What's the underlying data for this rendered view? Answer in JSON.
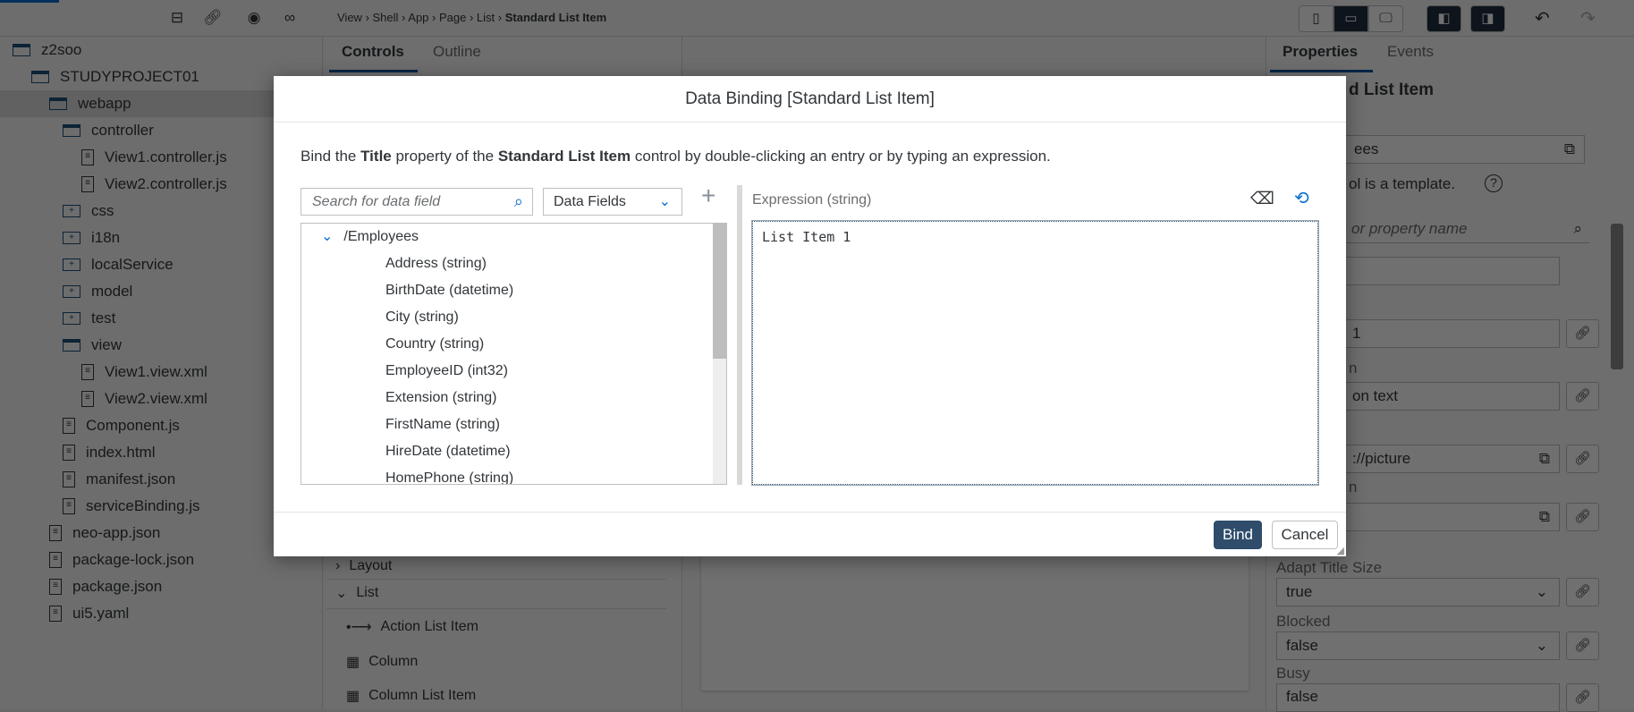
{
  "toolbar": {
    "breadcrumb": [
      "View",
      "Shell",
      "App",
      "Page",
      "List"
    ],
    "breadcrumb_current": "Standard List Item",
    "left_icons": [
      "collapse-all-icon",
      "link-icon",
      "eye-icon",
      "binoculars-icon"
    ]
  },
  "tree": [
    {
      "label": "z2soo",
      "type": "folder-open",
      "level": 0
    },
    {
      "label": "STUDYPROJECT01",
      "type": "folder-open",
      "level": 1
    },
    {
      "label": "webapp",
      "type": "folder-open",
      "level": 2,
      "selected": true
    },
    {
      "label": "controller",
      "type": "folder-open",
      "level": 3
    },
    {
      "label": "View1.controller.js",
      "type": "file",
      "level": 4
    },
    {
      "label": "View2.controller.js",
      "type": "file",
      "level": 4
    },
    {
      "label": "css",
      "type": "folder-closed",
      "level": 3
    },
    {
      "label": "i18n",
      "type": "folder-closed",
      "level": 3
    },
    {
      "label": "localService",
      "type": "folder-closed",
      "level": 3
    },
    {
      "label": "model",
      "type": "folder-closed",
      "level": 3
    },
    {
      "label": "test",
      "type": "folder-closed",
      "level": 3
    },
    {
      "label": "view",
      "type": "folder-open",
      "level": 3
    },
    {
      "label": "View1.view.xml",
      "type": "file",
      "level": 4
    },
    {
      "label": "View2.view.xml",
      "type": "file",
      "level": 4
    },
    {
      "label": "Component.js",
      "type": "file",
      "level": 3
    },
    {
      "label": "index.html",
      "type": "file",
      "level": 3
    },
    {
      "label": "manifest.json",
      "type": "file",
      "level": 3
    },
    {
      "label": "serviceBinding.js",
      "type": "file",
      "level": 3
    },
    {
      "label": "neo-app.json",
      "type": "file",
      "level": 2
    },
    {
      "label": "package-lock.json",
      "type": "file",
      "level": 2
    },
    {
      "label": "package.json",
      "type": "file",
      "level": 2
    },
    {
      "label": "ui5.yaml",
      "type": "file",
      "level": 2
    }
  ],
  "controls": {
    "tabs": [
      "Controls",
      "Outline"
    ],
    "active_tab": "Controls",
    "groups": [
      {
        "label": "Layout",
        "expanded": false
      },
      {
        "label": "List",
        "expanded": true
      }
    ],
    "items": [
      "Action List Item",
      "Column",
      "Column List Item"
    ]
  },
  "properties": {
    "tabs": [
      "Properties",
      "Events"
    ],
    "active_tab": "Properties",
    "title": "d List Item",
    "items_value": "ees",
    "template_note": "ol is a template.",
    "search_placeholder": "or property name",
    "title_value": "1",
    "label2": "n",
    "desc_value": "on text",
    "icon_value": "://picture",
    "label4": "n",
    "adapt_label": "Adapt Title Size",
    "adapt_value": "true",
    "blocked_label": "Blocked",
    "blocked_value": "false",
    "busy_label": "Busy",
    "busy_value": "false"
  },
  "dialog": {
    "title": "Data Binding [Standard List Item]",
    "desc_pre": "Bind the ",
    "desc_prop": "Title",
    "desc_mid": " property of the ",
    "desc_ctrl": "Standard List Item",
    "desc_post": " control by double-clicking an entry or by typing an expression.",
    "search_placeholder": "Search for data field",
    "filter_value": "Data Fields",
    "root": "/Employees",
    "fields": [
      "Address (string)",
      "BirthDate (datetime)",
      "City (string)",
      "Country (string)",
      "EmployeeID (int32)",
      "Extension (string)",
      "FirstName (string)",
      "HireDate (datetime)",
      "HomePhone (string)"
    ],
    "expression_label": "Expression (string)",
    "expression_value": "List Item 1",
    "bind_label": "Bind",
    "cancel_label": "Cancel",
    "accent": "#2f4d6b"
  }
}
